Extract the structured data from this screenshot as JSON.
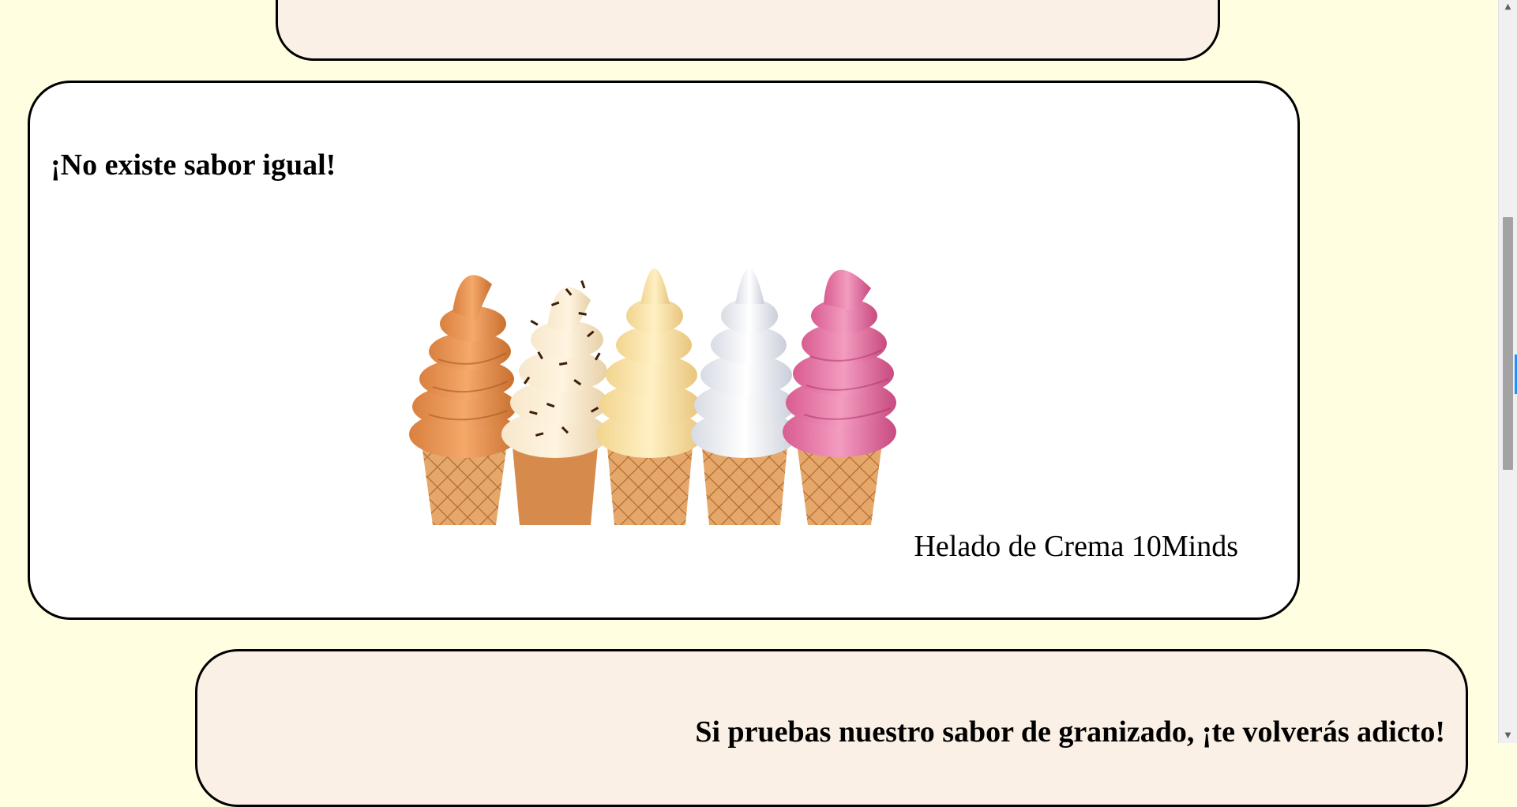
{
  "top_card": {
    "image": "ice-cream-cones-image"
  },
  "main_card": {
    "heading": "¡No existe sabor igual!",
    "image": "soft-serve-ice-cream-cones-image",
    "caption": "Helado de Crema 10Minds"
  },
  "bottom_card": {
    "heading": "Si pruebas nuestro sabor de granizado, ¡te volverás adicto!"
  },
  "scrollbar": {
    "up_icon": "▲",
    "down_icon": "▼",
    "position": 0.35
  },
  "colors": {
    "page_background": "#fffee0",
    "card_cream": "#faf0e6",
    "card_white": "#ffffff",
    "border": "#000000",
    "cone": "#d9904f",
    "flavors": [
      "#f0a060",
      "#a86434",
      "#ffe6a8",
      "#eceff4",
      "#e87aa8"
    ]
  }
}
